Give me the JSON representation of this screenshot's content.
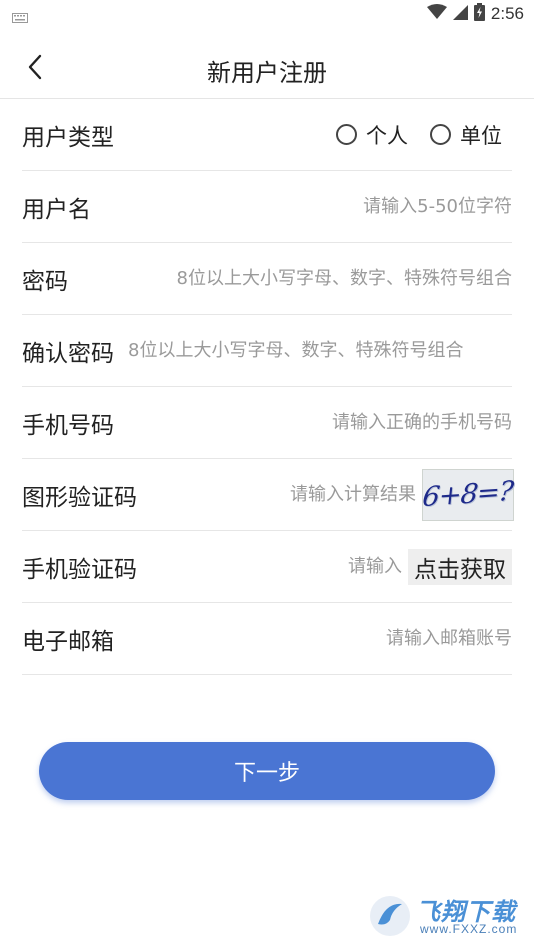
{
  "status_bar": {
    "time": "2:56"
  },
  "header": {
    "title": "新用户注册"
  },
  "form": {
    "user_type": {
      "label": "用户类型",
      "options": [
        "个人",
        "单位"
      ]
    },
    "username": {
      "label": "用户名",
      "placeholder": "请输入5-50位字符"
    },
    "password": {
      "label": "密码",
      "placeholder": "8位以上大小写字母、数字、特殊符号组合"
    },
    "confirm_password": {
      "label": "确认密码",
      "placeholder": "8位以上大小写字母、数字、特殊符号组合"
    },
    "phone": {
      "label": "手机号码",
      "placeholder": "请输入正确的手机号码"
    },
    "captcha": {
      "label": "图形验证码",
      "placeholder": "请输入计算结果",
      "image_text": "6+8=?"
    },
    "sms_code": {
      "label": "手机验证码",
      "placeholder": "请输入",
      "button": "点击获取"
    },
    "email": {
      "label": "电子邮箱",
      "placeholder": "请输入邮箱账号"
    }
  },
  "next_button": "下一步",
  "watermark": {
    "title": "飞翔下载",
    "url": "www.FXXZ.com"
  },
  "colors": {
    "primary": "#4a75d3",
    "divider": "#e6e6e6",
    "placeholder": "#9a9a9a"
  }
}
